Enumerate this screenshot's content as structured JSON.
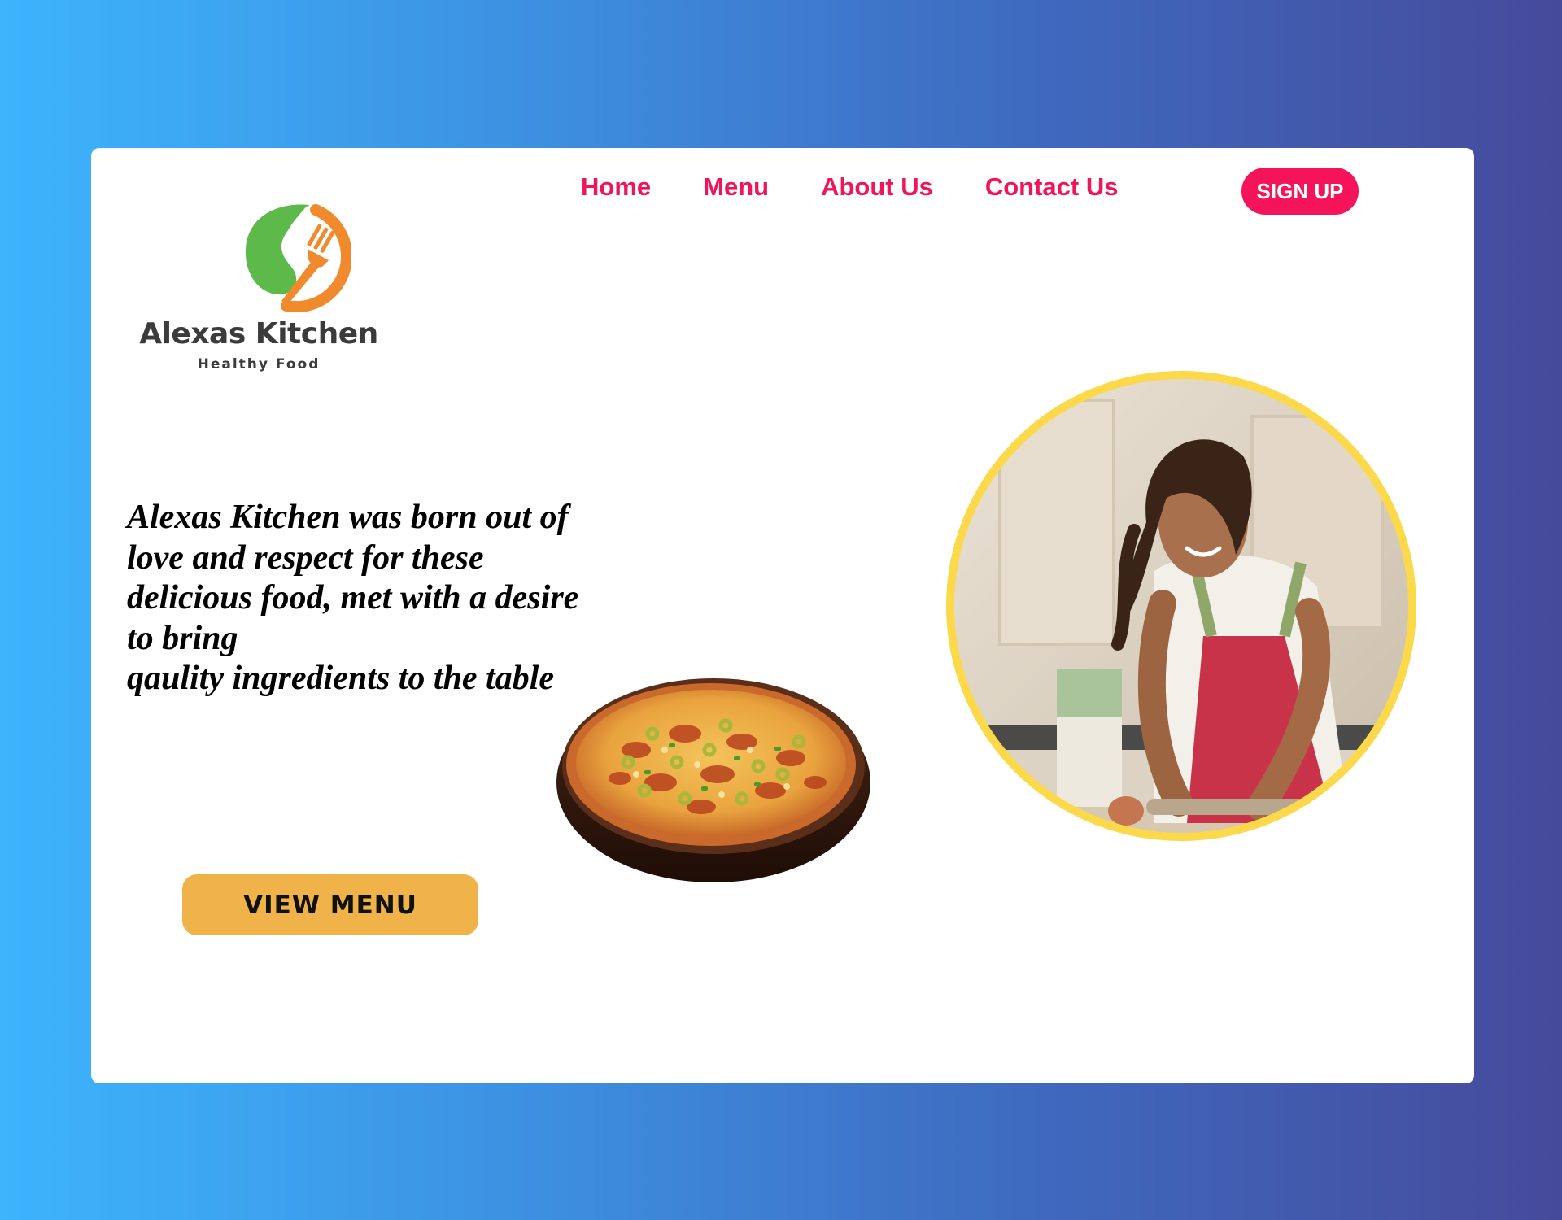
{
  "brand": {
    "name": "Alexas Kitchen",
    "tagline": "Healthy Food",
    "colors": {
      "leaf": "#5cb94a",
      "fork": "#f08a2c",
      "text": "#3b3b3b"
    }
  },
  "nav": {
    "items": [
      {
        "label": "Home"
      },
      {
        "label": "Menu"
      },
      {
        "label": "About Us"
      },
      {
        "label": "Contact Us"
      }
    ],
    "signup_label": "SIGN UP"
  },
  "hero": {
    "lines": [
      "Alexas Kitchen was born out of",
      "love and respect for these",
      "delicious food, met with a desire",
      "to bring",
      "qaulity ingredients to the table"
    ],
    "cta_label": "VIEW MENU"
  },
  "media": {
    "food_image": "pizza",
    "chef_image": "woman-rolling-dough",
    "photo_ring_color": "#fbd94a"
  },
  "theme": {
    "accent": "#f5145a",
    "cta_color": "#f0b349",
    "background_gradient": [
      "#3db4fd",
      "#464a9b"
    ]
  }
}
